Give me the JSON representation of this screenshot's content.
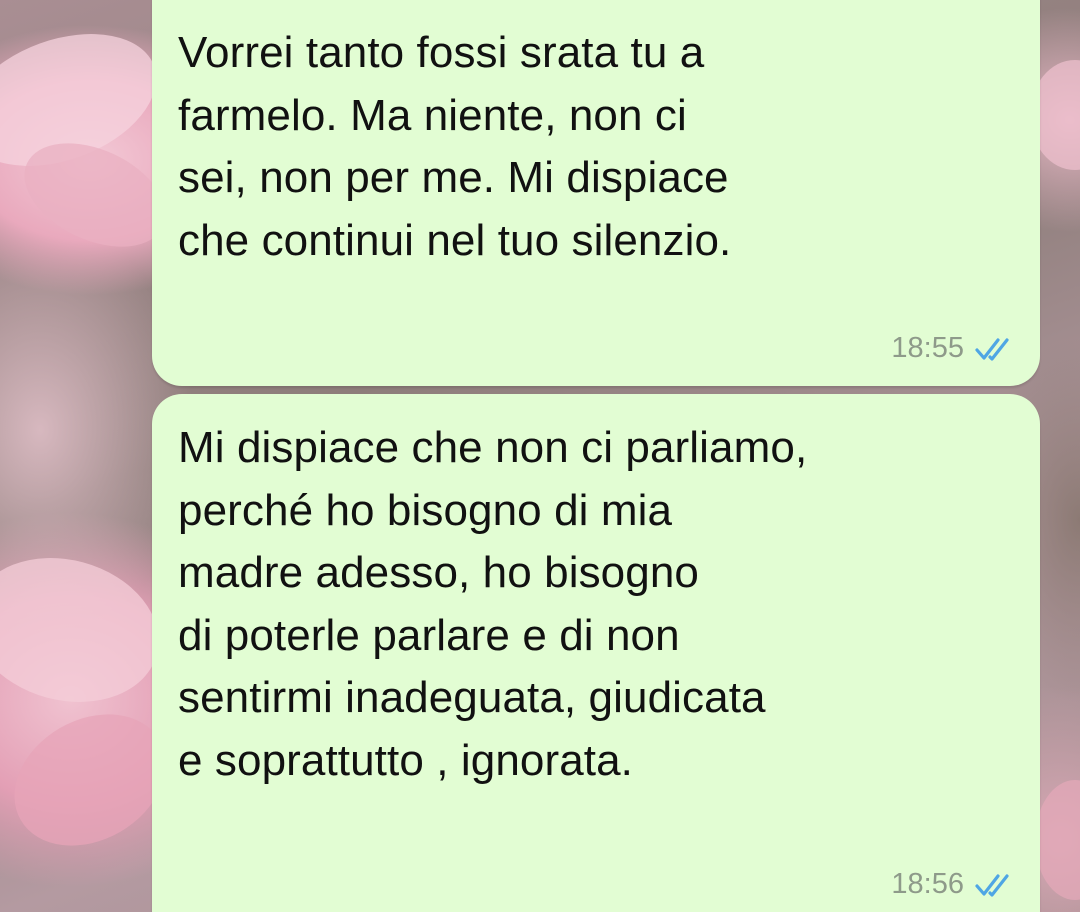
{
  "messages": [
    {
      "text": "Vorrei tanto fossi srata tu a\nfarmelo. Ma niente, non ci\nsei, non per me. Mi dispiace\nche continui nel tuo silenzio.",
      "time": "18:55",
      "status_icon": "double-check-read-icon"
    },
    {
      "text": "Mi dispiace che non ci parliamo,\nperché ho bisogno di mia\nmadre adesso, ho bisogno\ndi poterle parlare e di non\nsentirmi inadeguata, giudicata\ne soprattutto , ignorata.",
      "time": "18:56",
      "status_icon": "double-check-read-icon"
    }
  ],
  "colors": {
    "bubble": "#e2fdd3",
    "text": "#111111",
    "time": "#8e9a8a",
    "read_ticks": "#4fa6e4",
    "wallpaper_accent": "#e9a9bd"
  }
}
